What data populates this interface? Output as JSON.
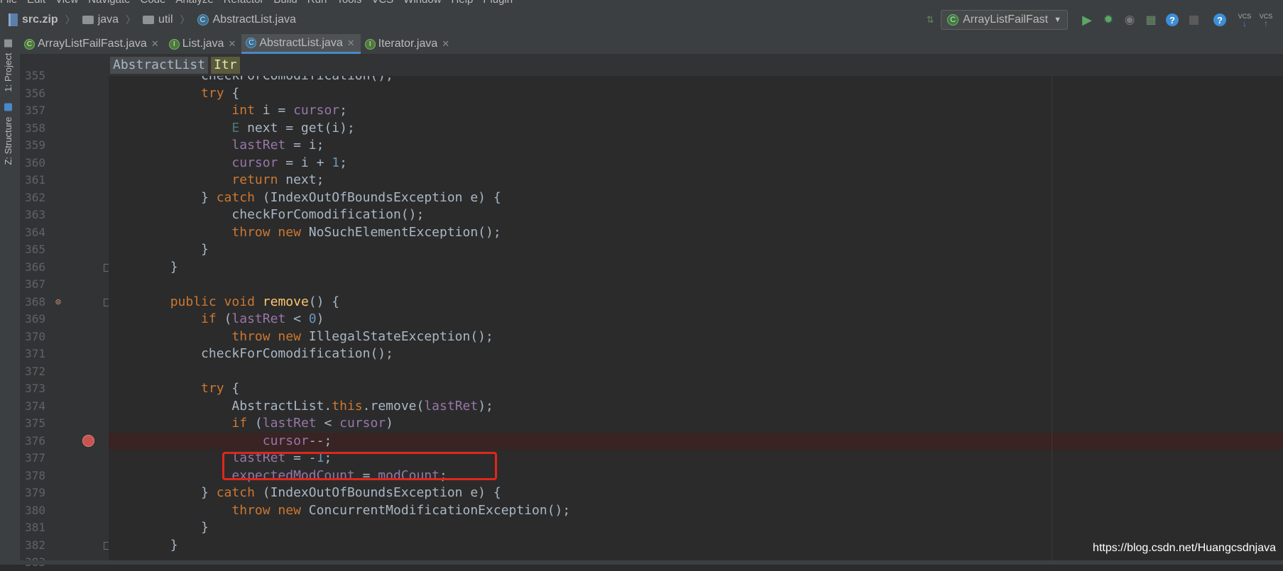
{
  "menu": [
    "File",
    "Edit",
    "View",
    "Navigate",
    "Code",
    "Analyze",
    "Refactor",
    "Build",
    "Run",
    "Tools",
    "VCS",
    "Window",
    "Help",
    "Plugin"
  ],
  "breadcrumb": [
    "src.zip",
    "java",
    "util",
    "AbstractList.java"
  ],
  "run_config": "ArrayListFailFast",
  "tabs": [
    {
      "label": "ArrayListFailFast.java",
      "icon": "class-icon",
      "color": "green"
    },
    {
      "label": "List.java",
      "icon": "interface-icon",
      "color": "interface"
    },
    {
      "label": "AbstractList.java",
      "icon": "class-icon",
      "color": "blue",
      "active": true
    },
    {
      "label": "Iterator.java",
      "icon": "interface-icon",
      "color": "interface"
    }
  ],
  "sidebar": {
    "project": "1: Project",
    "structure": "Z: Structure"
  },
  "structure_path": [
    "AbstractList",
    "Itr"
  ],
  "code_lines": [
    {
      "n": "355",
      "html": "            <span>checkForComodification</span>();"
    },
    {
      "n": "356",
      "html": "            <span class=\"kw\">try</span> {"
    },
    {
      "n": "357",
      "html": "                <span class=\"kw\">int</span> i = <span class=\"fld\">cursor</span>;"
    },
    {
      "n": "358",
      "html": "                <span class=\"typ\">E</span> next = get(i);"
    },
    {
      "n": "359",
      "html": "                <span class=\"fld\">lastRet</span> = i;"
    },
    {
      "n": "360",
      "html": "                <span class=\"fld\">cursor</span> = i + <span class=\"num\">1</span>;"
    },
    {
      "n": "361",
      "html": "                <span class=\"kw\">return</span> next;"
    },
    {
      "n": "362",
      "html": "            } <span class=\"kw\">catch</span> (IndexOutOfBoundsException e) {"
    },
    {
      "n": "363",
      "html": "                checkForComodification();"
    },
    {
      "n": "364",
      "html": "                <span class=\"kw\">throw new</span> NoSuchElementException();"
    },
    {
      "n": "365",
      "html": "            }"
    },
    {
      "n": "366",
      "html": "        }"
    },
    {
      "n": "367",
      "html": ""
    },
    {
      "n": "368",
      "html": "        <span class=\"kw\">public void</span> <span class=\"fn\">remove</span>() {"
    },
    {
      "n": "369",
      "html": "            <span class=\"kw\">if</span> (<span class=\"fld\">lastRet</span> &lt; <span class=\"num\">0</span>)"
    },
    {
      "n": "370",
      "html": "                <span class=\"kw\">throw new</span> IllegalStateException();"
    },
    {
      "n": "371",
      "html": "            checkForComodification();"
    },
    {
      "n": "372",
      "html": ""
    },
    {
      "n": "373",
      "html": "            <span class=\"kw\">try</span> {"
    },
    {
      "n": "374",
      "html": "                AbstractList.<span class=\"kw\">this</span>.remove(<span class=\"fld\">lastRet</span>);"
    },
    {
      "n": "375",
      "html": "                <span class=\"kw\">if</span> (<span class=\"fld\">lastRet</span> &lt; <span class=\"fld\">cursor</span>)"
    },
    {
      "n": "376",
      "html": "                    <span class=\"fld\">cursor</span>--;"
    },
    {
      "n": "377",
      "html": "                <span class=\"fld\">lastRet</span> = -<span class=\"num\">1</span>;"
    },
    {
      "n": "378",
      "html": "                <span class=\"fld\">expectedModCount</span> = <span class=\"fld\">modCount</span>;"
    },
    {
      "n": "379",
      "html": "            } <span class=\"kw\">catch</span> (IndexOutOfBoundsException e) {"
    },
    {
      "n": "380",
      "html": "                <span class=\"kw\">throw new</span> ConcurrentModificationException();"
    },
    {
      "n": "381",
      "html": "            }"
    },
    {
      "n": "382",
      "html": "        }"
    },
    {
      "n": "383",
      "html": ""
    }
  ],
  "breakpoint_line": "376",
  "watermark": "https://blog.csdn.net/Huangcsdnjava",
  "colors": {
    "keyword": "#cc7832",
    "field": "#9876aa",
    "number": "#6897bb",
    "method": "#ffc66d",
    "highlight_box": "#e1261c"
  }
}
